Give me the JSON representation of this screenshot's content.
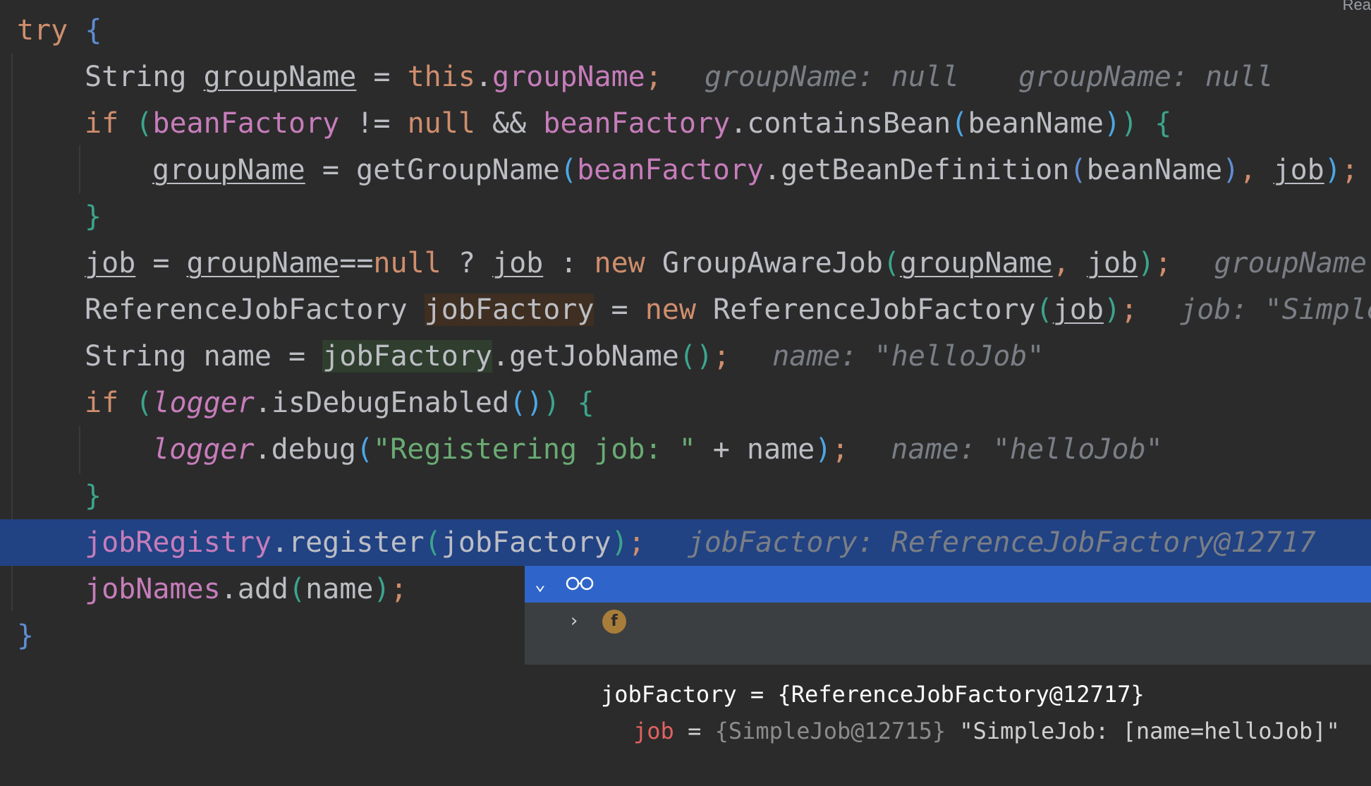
{
  "corner_label": "Rea",
  "code": {
    "l1": {
      "kw": "try",
      "brace": "{"
    },
    "l2": {
      "type": "String",
      "var": "groupName",
      "eq": " = ",
      "this": "this",
      "dot": ".",
      "field": "groupName",
      "semi": ";",
      "hint1": "groupName: null",
      "hint2": "groupName: null"
    },
    "l3": {
      "kw": "if",
      "p1": "(",
      "a": "beanFactory",
      "op": " != ",
      "nul": "null",
      "and": " && ",
      "b": "beanFactory",
      "call": ".containsBean",
      "p2": "(",
      "arg": "beanName",
      "p3": ")",
      "p4": ")",
      "brace": "{"
    },
    "l4": {
      "var": "groupName",
      "eq": " = getGroupName",
      "p1": "(",
      "bf": "beanFactory",
      "call": ".getBeanDefinition",
      "p2": "(",
      "arg": "beanName",
      "p3": ")",
      "comma": ", ",
      "job": "job",
      "p4": ")",
      "semi": ";"
    },
    "l5": {
      "brace": "}"
    },
    "l6": {
      "job": "job",
      "eq": " = ",
      "gn": "groupName",
      "eqeq": "==",
      "nul": "null",
      "q": " ? ",
      "job2": "job",
      "col": " : ",
      "new": "new",
      "cls": " GroupAwareJob",
      "p1": "(",
      "gn2": "groupName",
      "comma": ", ",
      "job3": "job",
      "p2": ")",
      "semi": ";",
      "hint": "groupName:"
    },
    "l7": {
      "type": "ReferenceJobFactory ",
      "var": "jobFactory",
      "eq": " = ",
      "new": "new",
      "cls": " ReferenceJobFactory",
      "p1": "(",
      "job": "job",
      "p2": ")",
      "semi": ";",
      "hint": "job: \"Simple"
    },
    "l8": {
      "type": "String name = ",
      "var": "jobFactory",
      "call": ".getJobName",
      "p": "()",
      "semi": ";",
      "hint": "name: \"helloJob\""
    },
    "l9": {
      "kw": "if",
      "p1": "(",
      "log": "logger",
      "call": ".isDebugEnabled",
      "p2": "()",
      "p3": ")",
      "brace": "{"
    },
    "l10": {
      "log": "logger",
      "call": ".debug",
      "p1": "(",
      "str": "\"Registering job: \"",
      "plus": " + name",
      "p2": ")",
      "semi": ";",
      "hint": "name: \"helloJob\""
    },
    "l11": {
      "brace": "}"
    },
    "l12": {
      "field": "jobRegistry",
      "call": ".register",
      "p1": "(",
      "arg": "jobFactory",
      "p2": ")",
      "semi": ";",
      "hint": "jobFactory: ReferenceJobFactory@12717"
    },
    "l13": {
      "field": "jobNames",
      "call": ".add",
      "p1": "(",
      "arg": "name",
      "p2": ")",
      "semi": ";"
    },
    "l14": {
      "brace": "}"
    }
  },
  "popup": {
    "row1_text": "jobFactory = {ReferenceJobFactory@12717}",
    "row2_name": "job",
    "row2_eq": " = ",
    "row2_type": "{SimpleJob@12715}",
    "row2_value": " \"SimpleJob: [name=helloJob]\"",
    "badge": "f"
  },
  "colors": {
    "background": "#2b2b2b",
    "execution_line": "#214283",
    "popup_selected": "#2f65ca"
  }
}
